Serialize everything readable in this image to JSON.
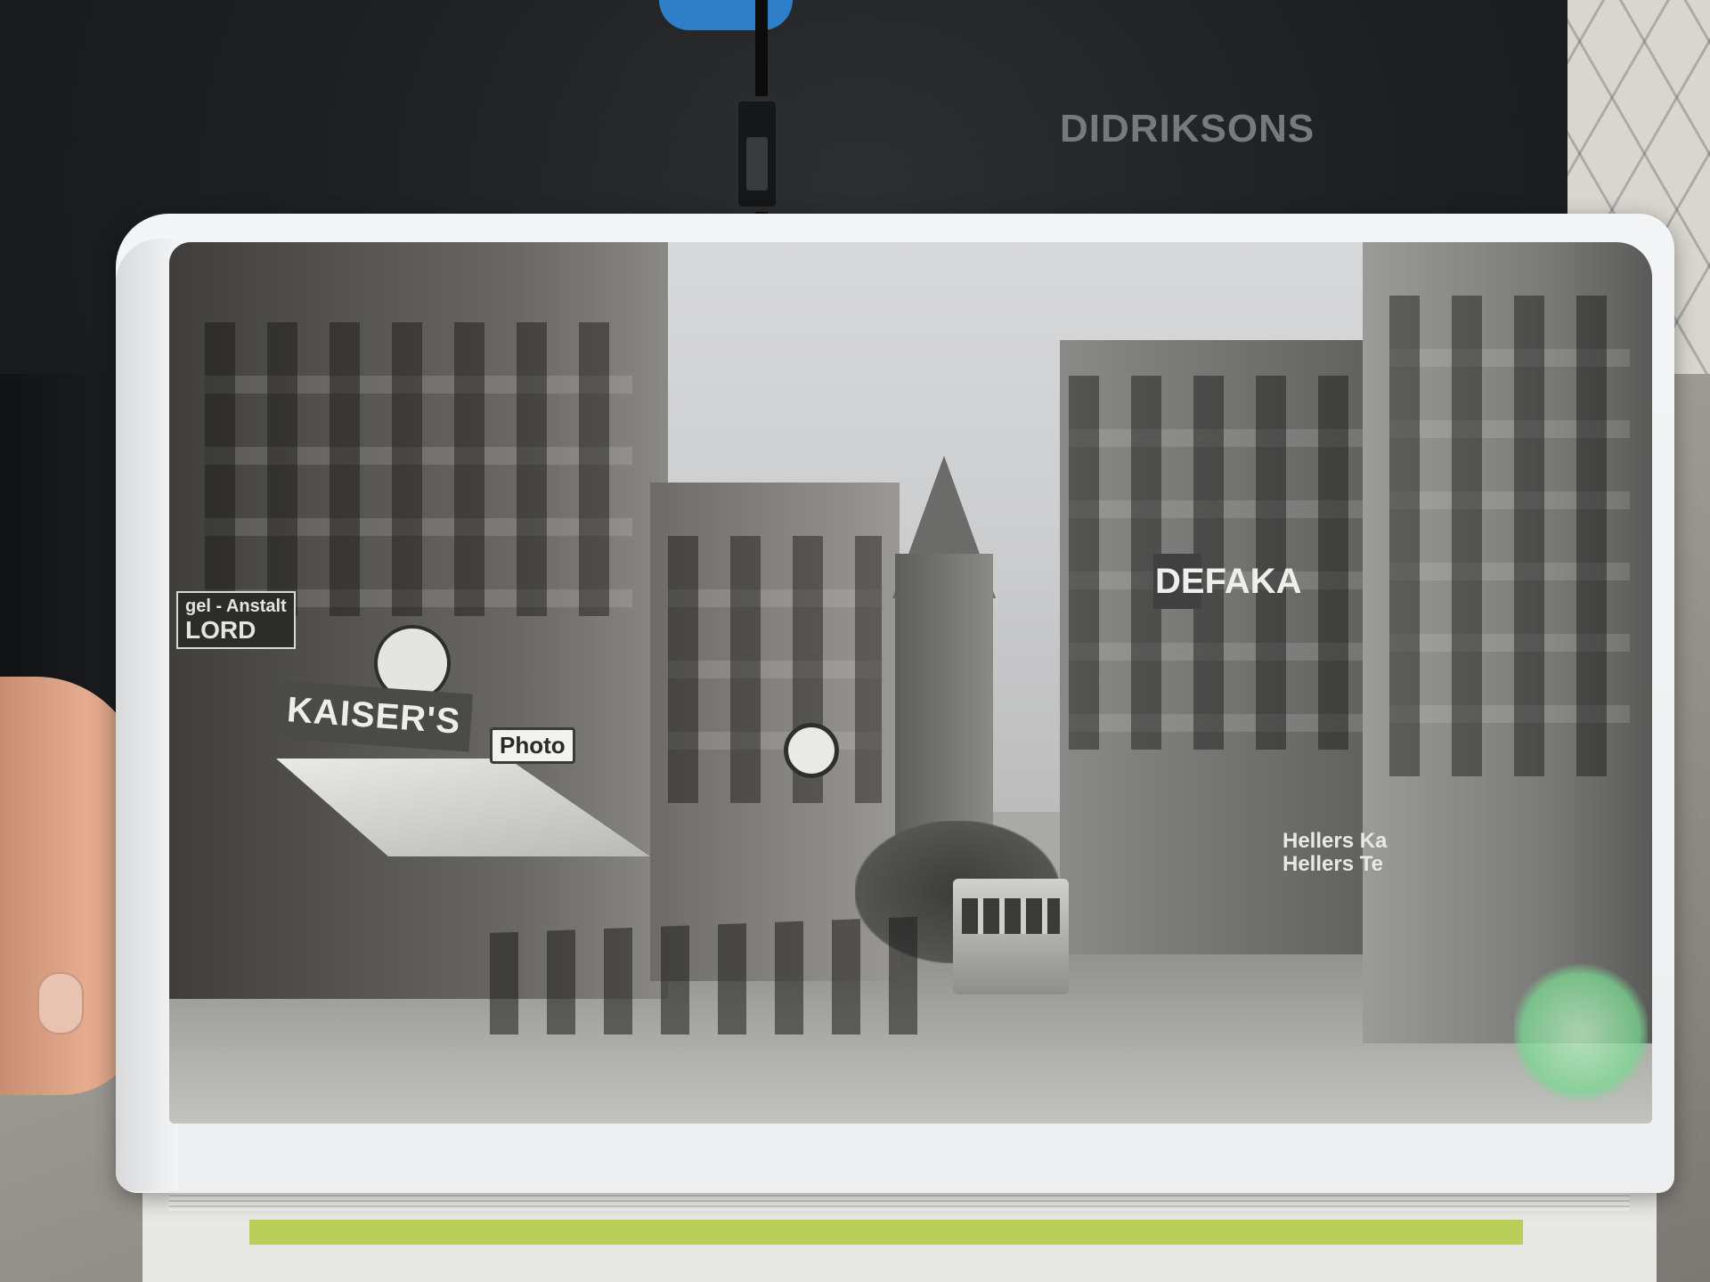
{
  "jacket": {
    "brand_text": "DIDRIKSONS"
  },
  "photo_signs": {
    "lord_small": "gel - Anstalt",
    "lord_big": "LORD",
    "kaisers": "KAISER'S",
    "photo": "Photo",
    "defaka": "DEFAKA",
    "hellers_line1": "Hellers Ka",
    "hellers_line2": "Hellers Te"
  },
  "colors": {
    "jacket": "#1d1f22",
    "scarf": "#2e7fc7",
    "brand_text": "#77797c",
    "page": "#f4f5f6",
    "photo_tone": "#a9a9a6",
    "book_green": "#b9cf5a"
  }
}
